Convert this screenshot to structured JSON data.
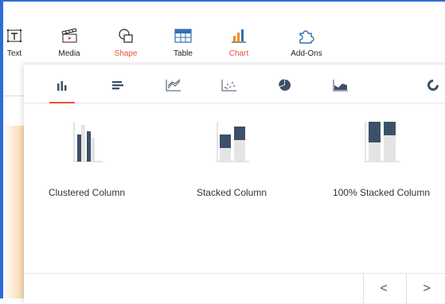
{
  "colors": {
    "accent": "#e8503a",
    "frame_blue": "#2d6bd9",
    "chart_dark": "#3e5069",
    "chart_light": "#e4e4e4",
    "chart_orange": "#ef8b22"
  },
  "ribbon": {
    "text_label": "Text",
    "media_label": "Media",
    "shape_label": "Shape",
    "table_label": "Table",
    "chart_label": "Chart",
    "addons_label": "Add-Ons"
  },
  "tabs": [
    {
      "icon": "column-chart-icon",
      "active": true
    },
    {
      "icon": "bar-chart-icon"
    },
    {
      "icon": "line-chart-icon"
    },
    {
      "icon": "scatter-chart-icon"
    },
    {
      "icon": "pie-chart-icon"
    },
    {
      "icon": "area-chart-icon"
    },
    {
      "icon": "donut-chart-icon"
    }
  ],
  "charts": [
    {
      "label": "Clustered Column",
      "icon": "clustered-column-icon"
    },
    {
      "label": "Stacked Column",
      "icon": "stacked-column-icon"
    },
    {
      "label": "100% Stacked Column",
      "icon": "stacked-100-column-icon"
    }
  ],
  "footer": {
    "prev_label": "<",
    "next_label": ">"
  }
}
